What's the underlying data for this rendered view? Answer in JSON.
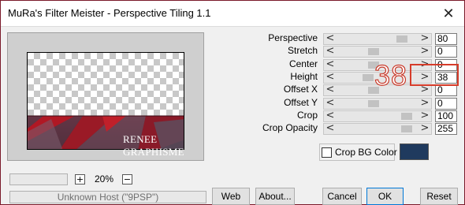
{
  "window": {
    "title": "MuRa's Filter Meister - Perspective Tiling 1.1",
    "close_glyph": "✕"
  },
  "preview": {
    "watermark": "RENEE GRAPHISME"
  },
  "zoom": {
    "plus": "+",
    "value": "20%",
    "minus": "−"
  },
  "host_status": "Unknown Host (\"9PSP\")",
  "params": [
    {
      "label": "Perspective",
      "value": "80",
      "level": 0.8
    },
    {
      "label": "Stretch",
      "value": "0",
      "level": 0.45
    },
    {
      "label": "Center",
      "value": "0",
      "level": 0.45
    },
    {
      "label": "Height",
      "value": "38",
      "level": 0.38
    },
    {
      "label": "Offset X",
      "value": "0",
      "level": 0.45
    },
    {
      "label": "Offset Y",
      "value": "0",
      "level": 0.45
    },
    {
      "label": "Crop",
      "value": "100",
      "level": 0.86
    },
    {
      "label": "Crop Opacity",
      "value": "255",
      "level": 0.86
    }
  ],
  "slider_arrows": {
    "left": "<",
    "right": ">"
  },
  "annotation": {
    "value": "38",
    "color": "#d63c2a"
  },
  "crop_bg": {
    "label": "Crop BG Color",
    "checked": false,
    "color": "#1f3a5e"
  },
  "buttons": {
    "web": "Web",
    "about": "About...",
    "cancel": "Cancel",
    "ok": "OK",
    "reset": "Reset"
  }
}
